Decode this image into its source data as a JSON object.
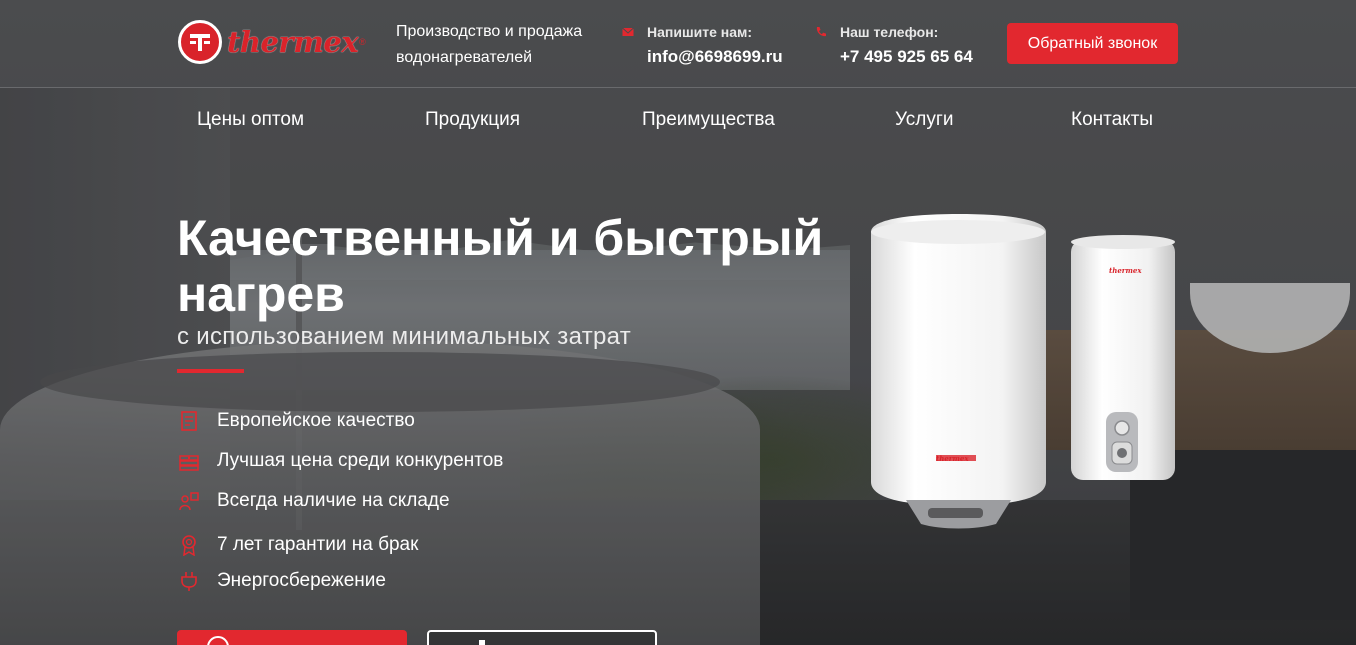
{
  "colors": {
    "accent": "#e2282f",
    "brand_red": "#d9232a"
  },
  "header": {
    "logo_text": "thermex",
    "tagline": "Производство и продажа водонагревателей",
    "email_label": "Напишите нам:",
    "email_value": "info@6698699.ru",
    "phone_label": "Наш телефон:",
    "phone_value": "+7 495 925 65 64",
    "callback_label": "Обратный звонок"
  },
  "nav": {
    "items": [
      {
        "label": "Цены оптом"
      },
      {
        "label": "Продукция"
      },
      {
        "label": "Преимущества"
      },
      {
        "label": "Услуги"
      },
      {
        "label": "Контакты"
      }
    ]
  },
  "hero": {
    "title": "Качественный и быстрый нагрев",
    "subtitle": "с использованием минимальных затрат",
    "features": [
      {
        "icon": "certificate-icon",
        "label": "Европейское качество"
      },
      {
        "icon": "money-stack-icon",
        "label": "Лучшая цена среди конкурентов"
      },
      {
        "icon": "warehouse-person-icon",
        "label": "Всегда наличие на складе"
      },
      {
        "icon": "award-ribbon-icon",
        "label": "7 лет гарантии на брак"
      },
      {
        "icon": "plug-icon",
        "label": "Энергосбережение"
      }
    ]
  },
  "products": [
    {
      "brand_mark": "thermex"
    },
    {
      "brand_mark": "thermex"
    }
  ]
}
